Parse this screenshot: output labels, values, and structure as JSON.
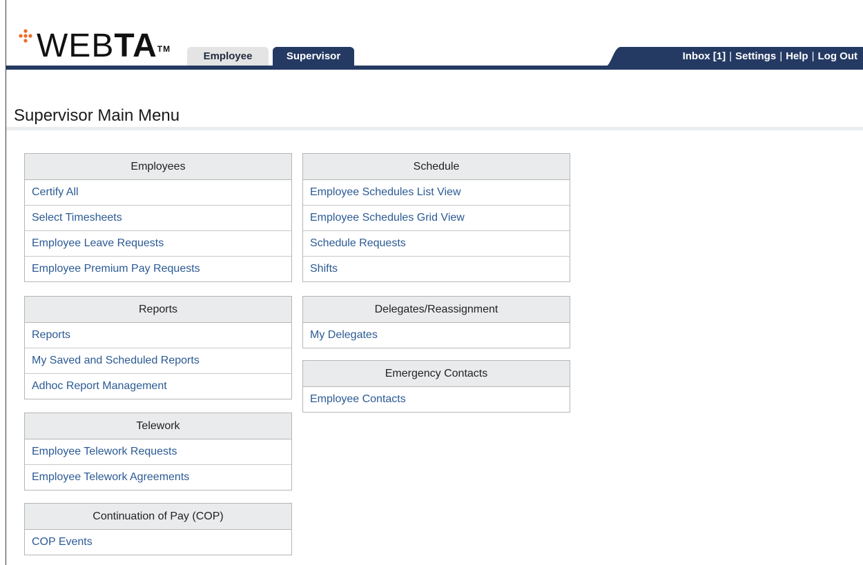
{
  "logo": {
    "light_text": "WEB",
    "bold_text": "TA",
    "trademark": "TM"
  },
  "tabs": [
    {
      "label": "Employee",
      "active": false
    },
    {
      "label": "Supervisor",
      "active": true
    }
  ],
  "utility_nav": {
    "inbox": "Inbox [1]",
    "settings": "Settings",
    "help": "Help",
    "logout": "Log Out",
    "separator": "|"
  },
  "page_title": "Supervisor Main Menu",
  "panels": {
    "employees": {
      "title": "Employees",
      "items": [
        "Certify All",
        "Select Timesheets",
        "Employee Leave Requests",
        "Employee Premium Pay Requests"
      ]
    },
    "reports": {
      "title": "Reports",
      "items": [
        "Reports",
        "My Saved and Scheduled Reports",
        "Adhoc Report Management"
      ]
    },
    "telework": {
      "title": "Telework",
      "items": [
        "Employee Telework Requests",
        "Employee Telework Agreements"
      ]
    },
    "cop": {
      "title": "Continuation of Pay (COP)",
      "items": [
        "COP Events"
      ]
    },
    "schedule": {
      "title": "Schedule",
      "items": [
        "Employee Schedules List View",
        "Employee Schedules Grid View",
        "Schedule Requests",
        "Shifts"
      ]
    },
    "delegates": {
      "title": "Delegates/Reassignment",
      "items": [
        "My Delegates"
      ]
    },
    "emergency": {
      "title": "Emergency Contacts",
      "items": [
        "Employee Contacts"
      ]
    }
  },
  "colors": {
    "nav_navy": "#243a63",
    "link_blue": "#2b5a94",
    "logo_orange": "#f26a21",
    "panel_header_bg": "#e9ebed"
  }
}
